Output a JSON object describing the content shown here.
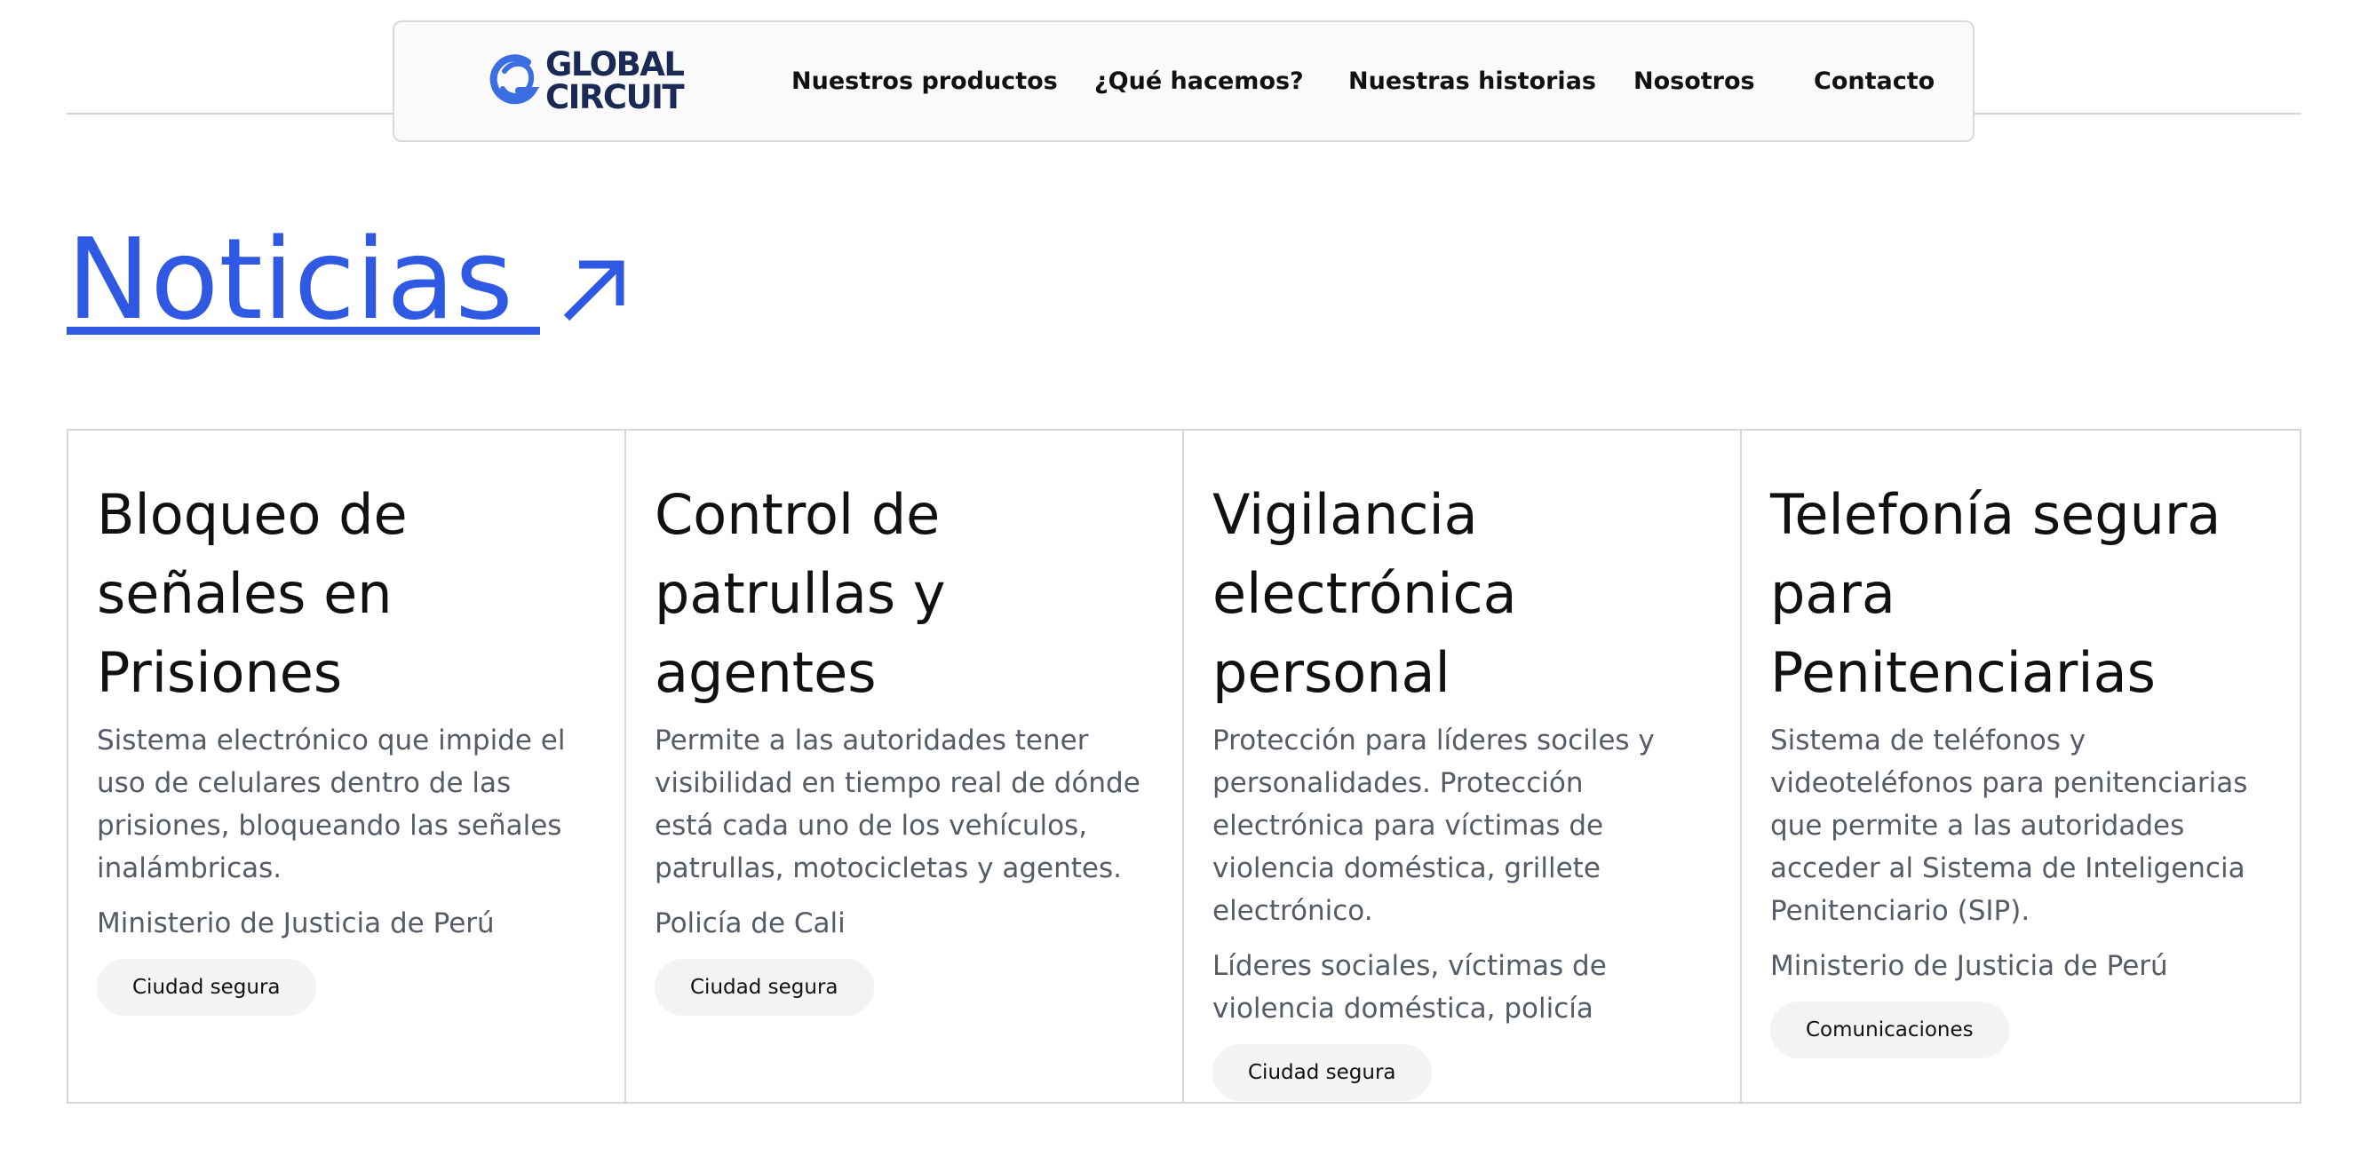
{
  "header": {
    "logo": {
      "line1": "GLOBAL",
      "line2": "CIRCUIT",
      "brand_color": "#1b2a55",
      "mark_color": "#3b6de3"
    },
    "nav": [
      {
        "label": "Nuestros productos"
      },
      {
        "label": "¿Qué hacemos?"
      },
      {
        "label": "Nuestras historias"
      },
      {
        "label": "Nosotros"
      },
      {
        "label": "Contacto"
      }
    ]
  },
  "news": {
    "heading": "Noticias",
    "accent_color": "#2f59e3",
    "icon": "arrow-up-right-icon"
  },
  "cards": [
    {
      "title": "Bloqueo de señales en Prisiones",
      "description": "Sistema electrónico que impide el uso de celulares dentro de las prisiones, bloqueando las señales inalámbricas.",
      "client": "Ministerio de Justicia de Perú",
      "tag": "Ciudad segura"
    },
    {
      "title": "Control de patrullas y agentes",
      "description": "Permite a las autoridades tener visibilidad en tiempo real de dónde está cada uno de los vehículos, patrullas, motocicletas y agentes.",
      "client": "Policía de Cali",
      "tag": "Ciudad segura"
    },
    {
      "title": "Vigilancia electrónica personal",
      "description": "Protección para líderes sociles y personalidades. Protección electrónica para víctimas de violencia doméstica, grillete electrónico.",
      "client": "Líderes sociales, víctimas de violencia doméstica, policía",
      "tag": "Ciudad segura"
    },
    {
      "title": "Telefonía segura para Penitenciarias",
      "description": "Sistema de teléfonos y videoteléfonos para penitenciarias que permite a las autoridades acceder al Sistema de Inteligencia Penitenciario (SIP).",
      "client": "Ministerio de Justicia de Perú",
      "tag": "Comunicaciones"
    }
  ]
}
